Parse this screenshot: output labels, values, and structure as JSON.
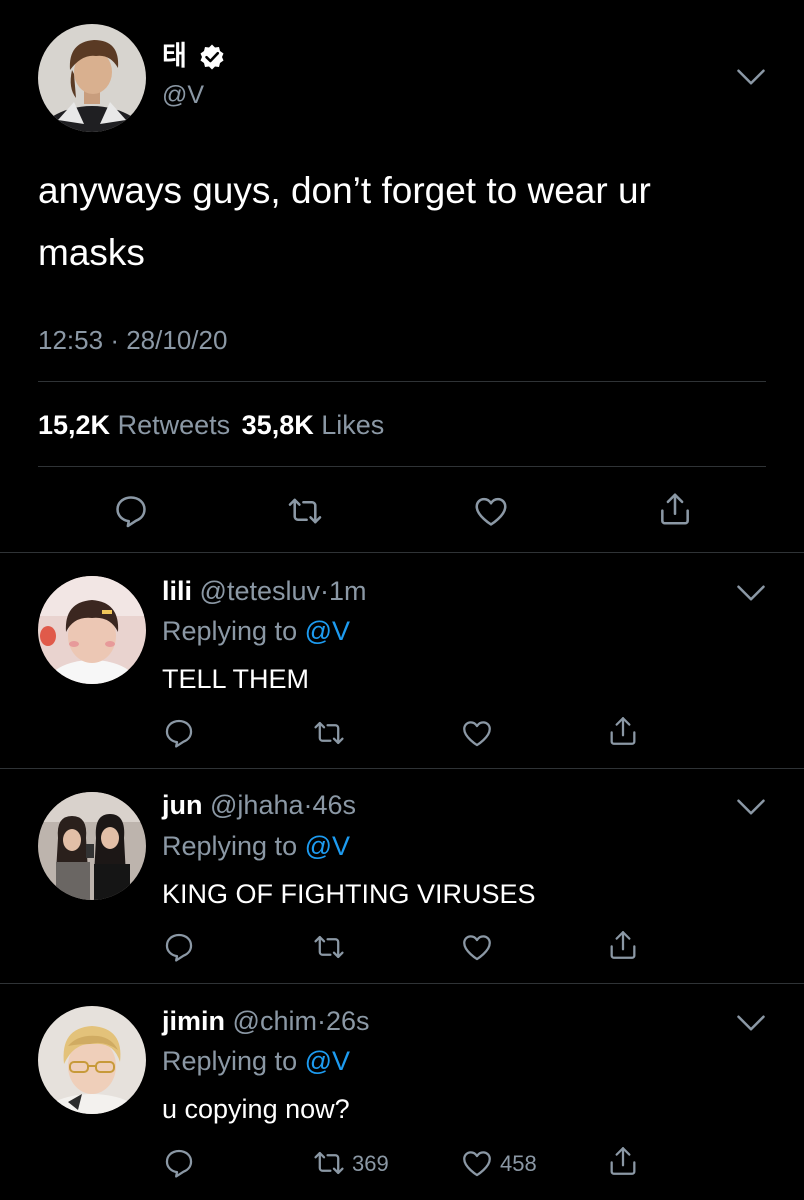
{
  "colors": {
    "background": "#000000",
    "text": "#ffffff",
    "secondary": "#8b98a5",
    "accent": "#1d9bf0",
    "divider": "#2f3336"
  },
  "main_tweet": {
    "display_name": "태",
    "verified_icon": "verified-badge-icon",
    "handle": "@V",
    "text_line1": "anyways guys, don’t forget to wear ur",
    "text_line2": "masks",
    "time": "12:53",
    "date": "28/10/20",
    "retweets_count": "15,2K",
    "retweets_label": "Retweets",
    "likes_count": "35,8K",
    "likes_label": "Likes",
    "actions": [
      "reply-icon",
      "retweet-icon",
      "like-icon",
      "share-icon"
    ]
  },
  "replies": [
    {
      "name": "lili",
      "handle": "@tetesluv",
      "time": "1m",
      "replying_prefix": "Replying to",
      "replying_to": "@V",
      "text": "TELL THEM",
      "retweet_count": "",
      "like_count": ""
    },
    {
      "name": "jun",
      "handle": "@jhaha",
      "time": "46s",
      "replying_prefix": "Replying to",
      "replying_to": "@V",
      "text": "KING OF FIGHTING VIRUSES",
      "retweet_count": "",
      "like_count": ""
    },
    {
      "name": "jimin",
      "handle": "@chim",
      "time": "26s",
      "replying_prefix": "Replying to",
      "replying_to": "@V",
      "text": "u copying now?",
      "retweet_count": "369",
      "like_count": "458"
    }
  ],
  "separator": "·"
}
